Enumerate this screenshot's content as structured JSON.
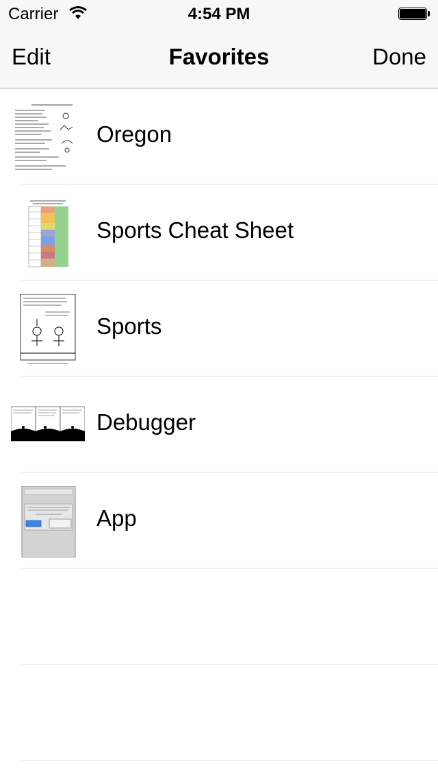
{
  "status": {
    "carrier": "Carrier",
    "time": "4:54 PM",
    "battery_level": 1.0
  },
  "nav": {
    "left_label": "Edit",
    "title": "Favorites",
    "right_label": "Done"
  },
  "favorites": [
    {
      "title": "Oregon"
    },
    {
      "title": "Sports Cheat Sheet"
    },
    {
      "title": "Sports"
    },
    {
      "title": "Debugger"
    },
    {
      "title": "App"
    }
  ],
  "colors": {
    "bar_background": "#f7f7f7",
    "separator": "#dcdcdc"
  }
}
